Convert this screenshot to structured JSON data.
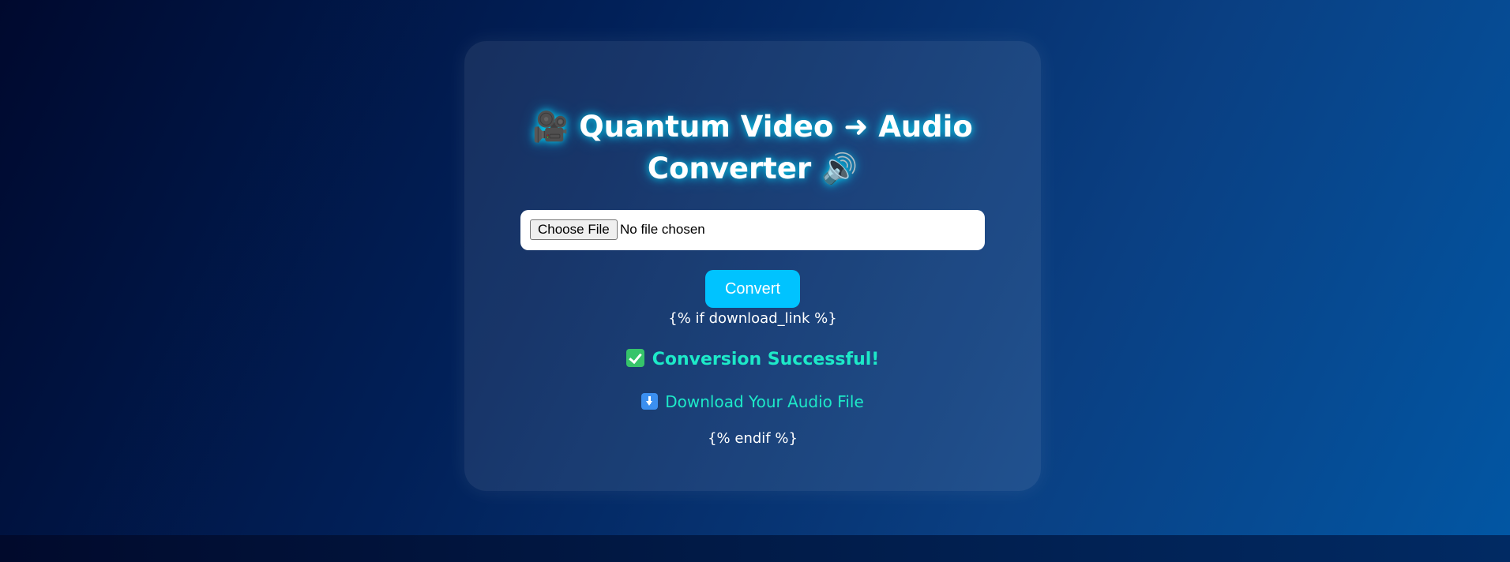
{
  "header": {
    "title_icon": "🎥",
    "title_line1": "Quantum Video ➜ Audio",
    "title_line2": "Converter",
    "title_trailing_icon": "🔊"
  },
  "upload": {
    "button_label": "Choose File",
    "status_text": "No file chosen"
  },
  "actions": {
    "convert_label": "Convert"
  },
  "template": {
    "if_tag": "{% if download_link %}",
    "endif_tag": "{% endif %}"
  },
  "result": {
    "success_text": "Conversion Successful!",
    "download_text": "Download Your Audio File"
  },
  "colors": {
    "accent": "#00c3ff",
    "success": "#1de9c8",
    "background_dark": "#00092e",
    "background_light": "#0256a3"
  },
  "icons": {
    "title_left": "video-camera-icon",
    "title_right": "speaker-icon",
    "success": "check-icon",
    "download": "download-arrow-icon"
  }
}
